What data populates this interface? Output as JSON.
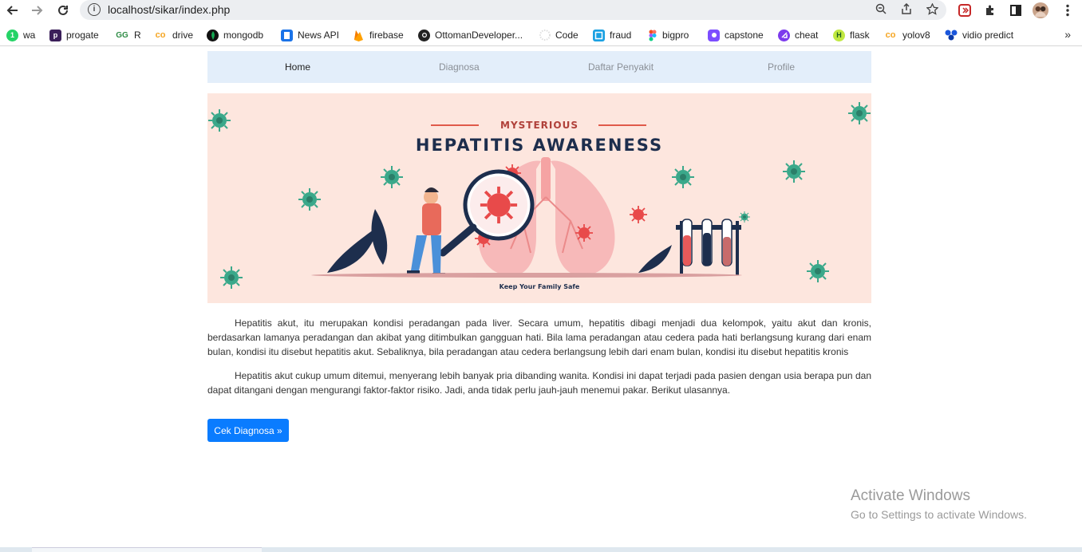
{
  "browser": {
    "url": "localhost/sikar/index.php",
    "bookmarks": [
      {
        "label": "wa",
        "icon": "whatsapp-icon",
        "color": "#25d366"
      },
      {
        "label": "progate",
        "icon": "progate-icon",
        "color": "#3b1f5a"
      },
      {
        "label": "R",
        "icon": "geeks-icon",
        "color": "#2f8d46"
      },
      {
        "label": "drive",
        "icon": "coursera-icon",
        "color": "#f5a623"
      },
      {
        "label": "mongodb",
        "icon": "mongodb-icon",
        "color": "#13aa52"
      },
      {
        "label": "News API",
        "icon": "newsapi-icon",
        "color": "#1a73e8"
      },
      {
        "label": "firebase",
        "icon": "firebase-icon",
        "color": "#ffa000"
      },
      {
        "label": "OttomanDeveloper...",
        "icon": "github-icon",
        "color": "#222222"
      },
      {
        "label": "Code",
        "icon": "code-icon",
        "color": "#dddddd"
      },
      {
        "label": "fraud",
        "icon": "fraud-icon",
        "color": "#1ba1e2"
      },
      {
        "label": "bigpro",
        "icon": "figma-icon",
        "color": "#a259ff"
      },
      {
        "label": "capstone",
        "icon": "capstone-icon",
        "color": "#7c4dff"
      },
      {
        "label": "cheat",
        "icon": "cheat-icon",
        "color": "#7c3aed"
      },
      {
        "label": "flask",
        "icon": "flask-icon",
        "color": "#4caf50"
      },
      {
        "label": "yolov8",
        "icon": "yolov8-icon",
        "color": "#f5a623"
      },
      {
        "label": "vidio predict",
        "icon": "vidio-icon",
        "color": "#1a56db"
      }
    ],
    "more": "»"
  },
  "nav": {
    "items": [
      {
        "label": "Home",
        "active": true
      },
      {
        "label": "Diagnosa",
        "active": false
      },
      {
        "label": "Daftar Penyakit",
        "active": false
      },
      {
        "label": "Profile",
        "active": false
      }
    ]
  },
  "hero": {
    "kicker": "MYSTERIOUS",
    "title": "HEPATITIS AWARENESS",
    "tagline": "Keep Your Family Safe"
  },
  "content": {
    "paragraphs": [
      "Hepatitis akut, itu merupakan kondisi peradangan pada liver. Secara umum, hepatitis dibagi menjadi dua kelompok, yaitu akut dan kronis, berdasarkan lamanya peradangan dan akibat yang ditimbulkan gangguan hati. Bila lama peradangan atau cedera pada hati berlangsung kurang dari enam bulan, kondisi itu disebut hepatitis akut. Sebaliknya, bila peradangan atau cedera berlangsung lebih dari enam bulan, kondisi itu disebut hepatitis kronis",
      "Hepatitis akut cukup umum ditemui, menyerang lebih banyak pria dibanding wanita. Kondisi ini dapat terjadi pada pasien dengan usia berapa pun dan dapat ditangani dengan mengurangi faktor-faktor risiko. Jadi, anda tidak perlu jauh-jauh menemui pakar. Berikut ulasannya."
    ],
    "cta_label": "Cek Diagnosa »"
  },
  "watermark": {
    "line1": "Activate Windows",
    "line2": "Go to Settings to activate Windows."
  }
}
